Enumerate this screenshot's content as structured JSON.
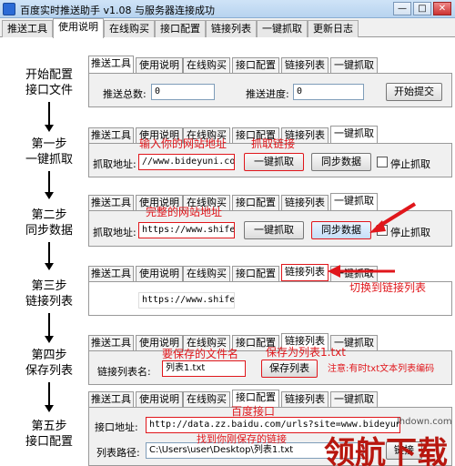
{
  "window": {
    "title": "百度实时推送助手 v1.08 与服务器连接成功",
    "min_glyph": "—",
    "max_glyph": "□",
    "close_glyph": "✕"
  },
  "tabs": [
    "推送工具",
    "使用说明",
    "在线购买",
    "接口配置",
    "链接列表",
    "一键抓取",
    "更新日志"
  ],
  "active_tab": "使用说明",
  "mini_tabs": [
    "推送工具",
    "使用说明",
    "在线购买",
    "接口配置",
    "链接列表",
    "一键抓取"
  ],
  "steps": {
    "s0": {
      "title_1": "开始配置",
      "title_2": "接口文件",
      "total_label": "推送总数:",
      "total_value": "0",
      "progress_label": "推送进度:",
      "progress_value": "0",
      "submit_button": "开始提交"
    },
    "s1": {
      "title_1": "第一步",
      "title_2": "一键抓取",
      "url_label": "抓取地址:",
      "url_value": "//www.bideyuni.com",
      "grab_button": "一键抓取",
      "sync_button": "同步数据",
      "stop_label": "停止抓取",
      "note_input": "输入你的网站地址",
      "note_grab": "抓取链接"
    },
    "s2": {
      "title_1": "第二步",
      "title_2": "同步数据",
      "url_label": "抓取地址:",
      "url_value": "https://www.shifeng",
      "grab_button": "一键抓取",
      "sync_button": "同步数据",
      "stop_label": "停止抓取",
      "note": "完整的网站地址"
    },
    "s3": {
      "title_1": "第三步",
      "title_2": "链接列表",
      "list_value": "https://www.shifeng",
      "note": "切换到链接列表"
    },
    "s4": {
      "title_1": "第四步",
      "title_2": "保存列表",
      "name_label": "链接列表名:",
      "name_value": "列表1.txt",
      "save_button": "保存列表",
      "note_name": "要保存的文件名",
      "note_save": "保存为列表1.txt",
      "note_warn": "注意:有时txt文本列表编码"
    },
    "s5": {
      "title_1": "第五步",
      "title_2": "接口配置",
      "api_label": "接口地址:",
      "api_value": "http://data.zz.baidu.com/urls?site=www.bideyuni.com&token=",
      "path_label": "列表路径:",
      "path_value": "C:\\Users\\user\\Desktop\\列表1.txt",
      "note_api": "百度接口",
      "note_path": "找到你刚保存的链接",
      "link_button": "链接"
    }
  },
  "watermark": {
    "text": "领航下载",
    "url": "lhdown.com"
  },
  "colors": {
    "annotation": "#e0161b",
    "titlebar": "#b7d3ef"
  }
}
